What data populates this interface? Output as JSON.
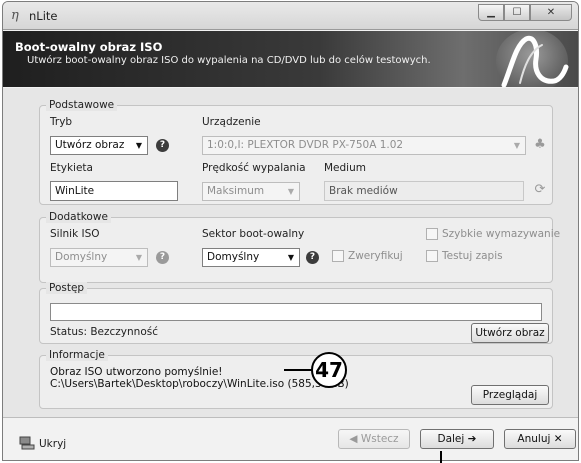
{
  "window": {
    "title": "nLite",
    "app_icon": "nlite-logo-icon",
    "controls": {
      "minimize": "minimize-icon",
      "maximize": "maximize-icon",
      "close": "close-icon"
    }
  },
  "header": {
    "title": "Boot-owalny obraz ISO",
    "subtitle": "Utwórz boot-owalny obraz ISO do wypalenia na CD/DVD lub do celów testowych."
  },
  "basic": {
    "legend": "Podstawowe",
    "mode_label": "Tryb",
    "mode_value": "Utwórz obraz",
    "device_label": "Urządzenie",
    "device_value": "1:0:0,I: PLEXTOR  DVDR   PX-750A  1.02",
    "label_label": "Etykieta",
    "label_value": "WinLite",
    "speed_label": "Prędkość wypalania",
    "speed_value": "Maksimum",
    "medium_label": "Medium",
    "medium_value": "Brak mediów"
  },
  "advanced": {
    "legend": "Dodatkowe",
    "engine_label": "Silnik ISO",
    "engine_value": "Domyślny",
    "boot_sector_label": "Sektor boot-owalny",
    "boot_sector_value": "Domyślny",
    "verify_label": "Zweryfikuj",
    "quick_erase_label": "Szybkie wymazywanie",
    "test_write_label": "Testuj zapis"
  },
  "progress": {
    "legend": "Postęp",
    "value": 0,
    "status": "Status: Bezczynność",
    "create_button": "Utwórz obraz"
  },
  "info": {
    "legend": "Informacje",
    "line1": "Obraz ISO utworzono pomyślnie!",
    "line2": "C:\\Users\\Bartek\\Desktop\\roboczy\\WinLite.iso (585,38MB)",
    "browse_button": "Przeglądaj"
  },
  "callout": {
    "number": "47"
  },
  "footer": {
    "hide_label": "Ukryj",
    "back_label": "Wstecz",
    "next_label": "Dalej",
    "cancel_label": "Anuluj"
  }
}
